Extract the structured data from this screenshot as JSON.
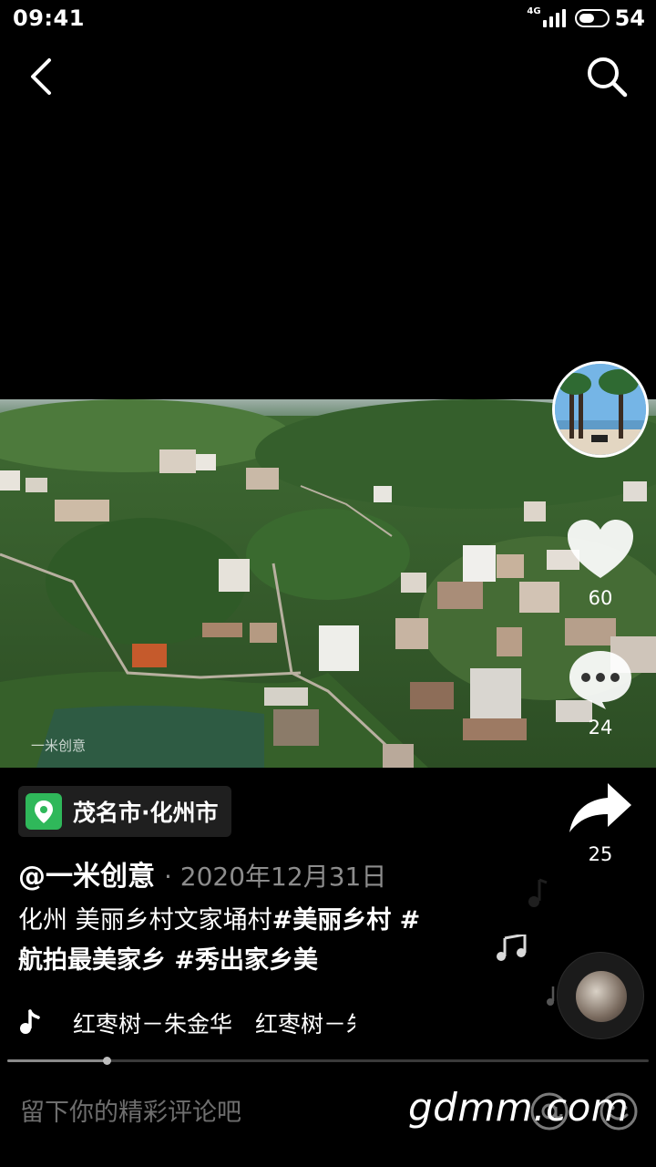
{
  "status_bar": {
    "time": "09:41",
    "network": "4G",
    "battery_level": "54",
    "battery_fill": 0.54
  },
  "video": {
    "watermark_text": "一米创意"
  },
  "actions": {
    "like_count": "60",
    "comment_count": "24",
    "share_count": "25"
  },
  "location": {
    "text": "茂名市·化州市"
  },
  "post": {
    "author": "@一米创意",
    "date": "· 2020年12月31日",
    "caption_plain": "化州 美丽乡村文家埇村",
    "hashtag_1": "#美丽乡村 #",
    "hashtag_2": "航拍最美家乡 #秀出家乡美"
  },
  "music": {
    "title": "红枣树－朱金华　红枣树－朱金华"
  },
  "playback": {
    "progress": 0.155
  },
  "comment_bar": {
    "placeholder": "留下你的精彩评论吧"
  },
  "overlay": {
    "site_watermark": "gdmm.com"
  },
  "icons": {
    "back": "back-arrow-icon",
    "search": "search-icon",
    "like": "heart-icon",
    "comment": "comment-bubble-icon",
    "share": "share-arrow-icon",
    "music": "music-note-icon",
    "at": "at-mention-icon",
    "emoji": "emoji-icon"
  },
  "colors": {
    "background": "#000000",
    "location_pin": "#2fb85a",
    "secondary_text": "#8c8c8c",
    "placeholder_text": "#6e6e6e"
  }
}
